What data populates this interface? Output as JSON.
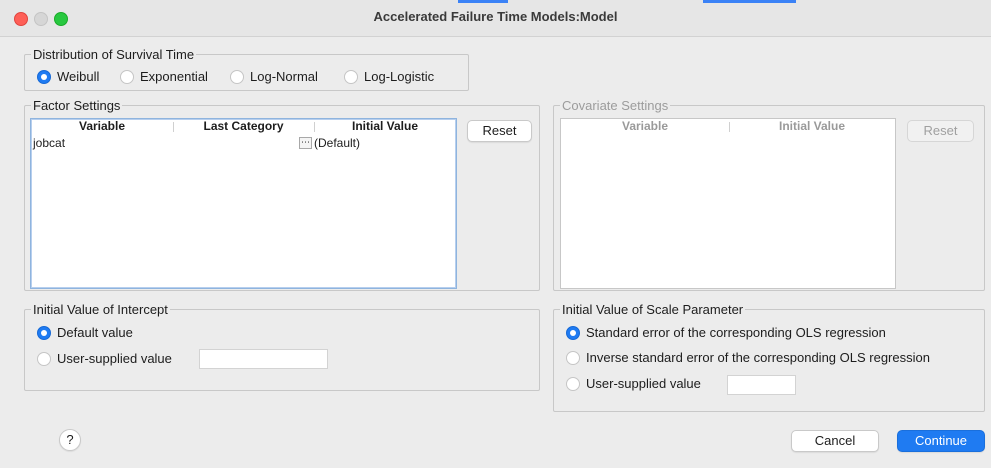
{
  "window": {
    "title": "Accelerated Failure Time Models:Model"
  },
  "distribution": {
    "legend": "Distribution of Survival Time",
    "options": [
      "Weibull",
      "Exponential",
      "Log-Normal",
      "Log-Logistic"
    ],
    "selected": "Weibull"
  },
  "factor_settings": {
    "legend": "Factor Settings",
    "columns": [
      "Variable",
      "Last Category",
      "Initial Value"
    ],
    "rows": [
      {
        "variable": "jobcat",
        "last_category": "",
        "initial_value": "(Default)",
        "dots": "⋯"
      }
    ],
    "reset_label": "Reset"
  },
  "covariate_settings": {
    "legend": "Covariate Settings",
    "columns": [
      "Variable",
      "Initial Value"
    ],
    "rows": [],
    "reset_label": "Reset"
  },
  "intercept": {
    "legend": "Initial Value of Intercept",
    "options": [
      "Default value",
      "User-supplied value"
    ],
    "selected": "Default value",
    "user_value": ""
  },
  "scale": {
    "legend": "Initial Value of Scale Parameter",
    "options": [
      "Standard error of the corresponding OLS regression",
      "Inverse standard error of the corresponding OLS regression",
      "User-supplied value"
    ],
    "selected": "Standard error of the corresponding OLS regression",
    "user_value": ""
  },
  "footer": {
    "help_label": "?",
    "cancel_label": "Cancel",
    "continue_label": "Continue"
  },
  "colors": {
    "accent": "#1f7bf2",
    "close": "#fe5f57",
    "maximize": "#28c840",
    "minimize_inactive": "#d6d6d6"
  }
}
